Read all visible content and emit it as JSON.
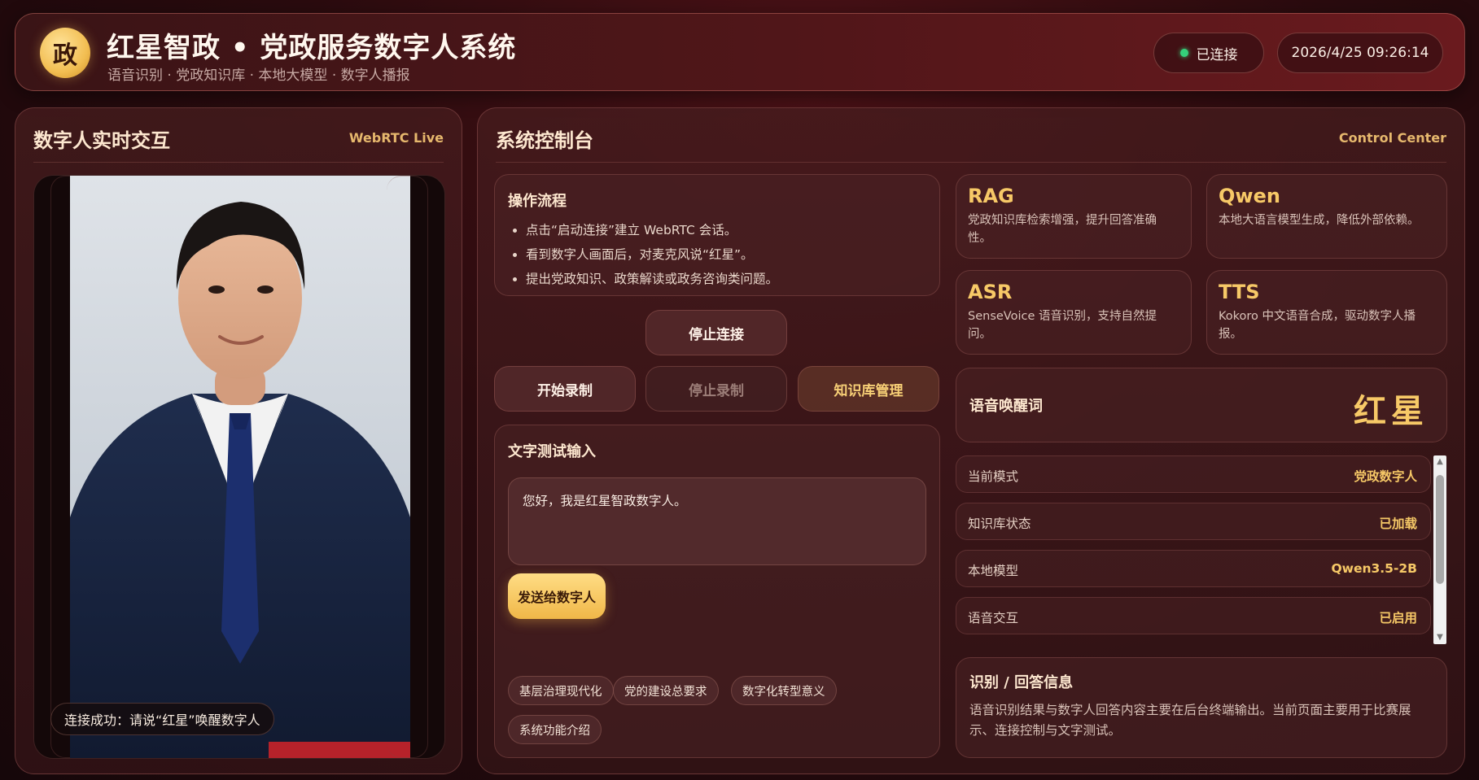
{
  "header": {
    "logo_char": "政",
    "title": "红星智政 • 党政服务数字人系统",
    "subtitle": "语音识别 · 党政知识库 · 本地大模型 · 数字人播报",
    "connection_status": "已连接",
    "datetime": "2026/4/25 09:26:14"
  },
  "left_panel": {
    "title": "数字人实时交互",
    "tag": "WebRTC Live",
    "toast": "连接成功：请说“红星”唤醒数字人"
  },
  "right_panel": {
    "title": "系统控制台",
    "tag": "Control Center",
    "workflow": {
      "title": "操作流程",
      "steps": [
        "点击“启动连接”建立 WebRTC 会话。",
        "看到数字人画面后，对麦克风说“红星”。",
        "提出党政知识、政策解读或政务咨询类问题。"
      ]
    },
    "buttons": {
      "stop_connect": "停止连接",
      "start_record": "开始录制",
      "stop_record": "停止录制",
      "kb_manage": "知识库管理"
    },
    "text_test": {
      "title": "文字测试输入",
      "input_value": "您好，我是红星智政数字人。",
      "send_label": "发送给数字人",
      "chips": [
        "基层治理现代化",
        "党的建设总要求",
        "数字化转型意义",
        "系统功能介绍"
      ]
    },
    "features": [
      {
        "name": "RAG",
        "desc": "党政知识库检索增强，提升回答准确性。"
      },
      {
        "name": "Qwen",
        "desc": "本地大语言模型生成，降低外部依赖。"
      },
      {
        "name": "ASR",
        "desc": "SenseVoice 语音识别，支持自然提问。"
      },
      {
        "name": "TTS",
        "desc": "Kokoro 中文语音合成，驱动数字人播报。"
      }
    ],
    "wake": {
      "label": "语音唤醒词",
      "word": "红星"
    },
    "status": [
      {
        "key": "当前模式",
        "value": "党政数字人"
      },
      {
        "key": "知识库状态",
        "value": "已加载"
      },
      {
        "key": "本地模型",
        "value": "Qwen3.5-2B"
      },
      {
        "key": "语音交互",
        "value": "已启用"
      }
    ],
    "info": {
      "title": "识别 / 回答信息",
      "text": "语音识别结果与数字人回答内容主要在后台终端输出。当前页面主要用于比赛展示、连接控制与文字测试。"
    }
  },
  "colors": {
    "accent_gold": "#f7c967",
    "status_green": "#35d07a",
    "bg_dark_red": "#2a0b0e"
  }
}
